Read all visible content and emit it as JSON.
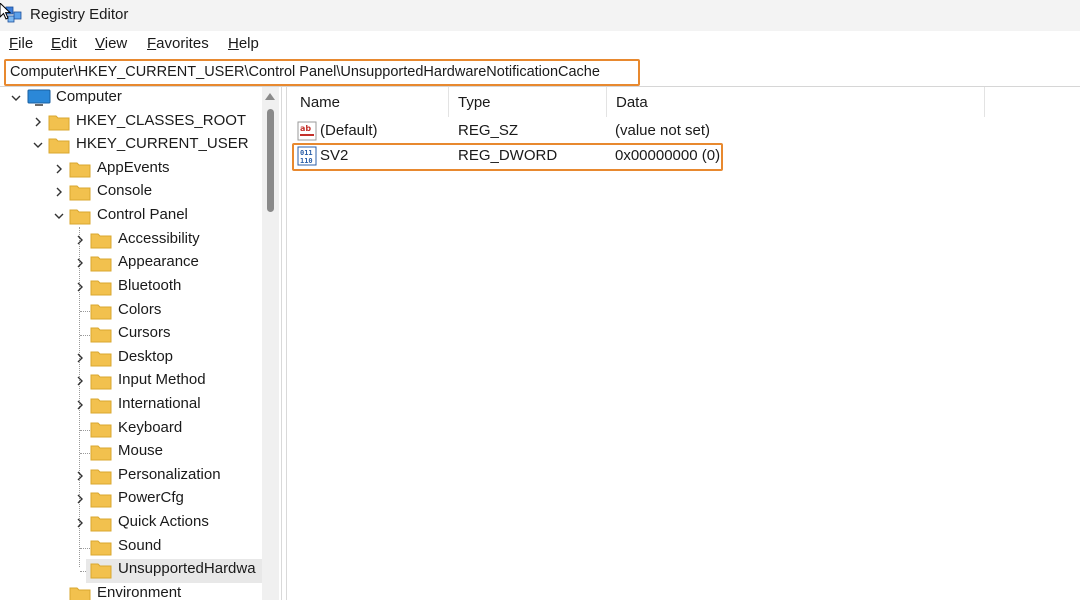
{
  "window": {
    "title": "Registry Editor"
  },
  "menu": [
    {
      "label": "File"
    },
    {
      "label": "Edit"
    },
    {
      "label": "View"
    },
    {
      "label": "Favorites"
    },
    {
      "label": "Help"
    }
  ],
  "address": {
    "path": "Computer\\HKEY_CURRENT_USER\\Control Panel\\UnsupportedHardwareNotificationCache"
  },
  "tree": {
    "items": [
      {
        "label": "Computer"
      },
      {
        "label": "HKEY_CLASSES_ROOT"
      },
      {
        "label": "HKEY_CURRENT_USER"
      },
      {
        "label": "AppEvents"
      },
      {
        "label": "Console"
      },
      {
        "label": "Control Panel"
      },
      {
        "label": "Accessibility"
      },
      {
        "label": "Appearance"
      },
      {
        "label": "Bluetooth"
      },
      {
        "label": "Colors"
      },
      {
        "label": "Cursors"
      },
      {
        "label": "Desktop"
      },
      {
        "label": "Input Method"
      },
      {
        "label": "International"
      },
      {
        "label": "Keyboard"
      },
      {
        "label": "Mouse"
      },
      {
        "label": "Personalization"
      },
      {
        "label": "PowerCfg"
      },
      {
        "label": "Quick Actions"
      },
      {
        "label": "Sound"
      },
      {
        "label": "UnsupportedHardwa"
      },
      {
        "label": "Environment"
      }
    ]
  },
  "list": {
    "columns": [
      {
        "label": "Name"
      },
      {
        "label": "Type"
      },
      {
        "label": "Data"
      }
    ],
    "rows": [
      {
        "name": "(Default)",
        "type": "REG_SZ",
        "data": "(value not set)",
        "icon": "string-value-icon"
      },
      {
        "name": "SV2",
        "type": "REG_DWORD",
        "data": "0x00000000 (0)",
        "icon": "binary-value-icon"
      }
    ]
  },
  "colors": {
    "highlight": "#e8892f",
    "folder": "#f2c14e",
    "monitor": "#2b88d8"
  }
}
